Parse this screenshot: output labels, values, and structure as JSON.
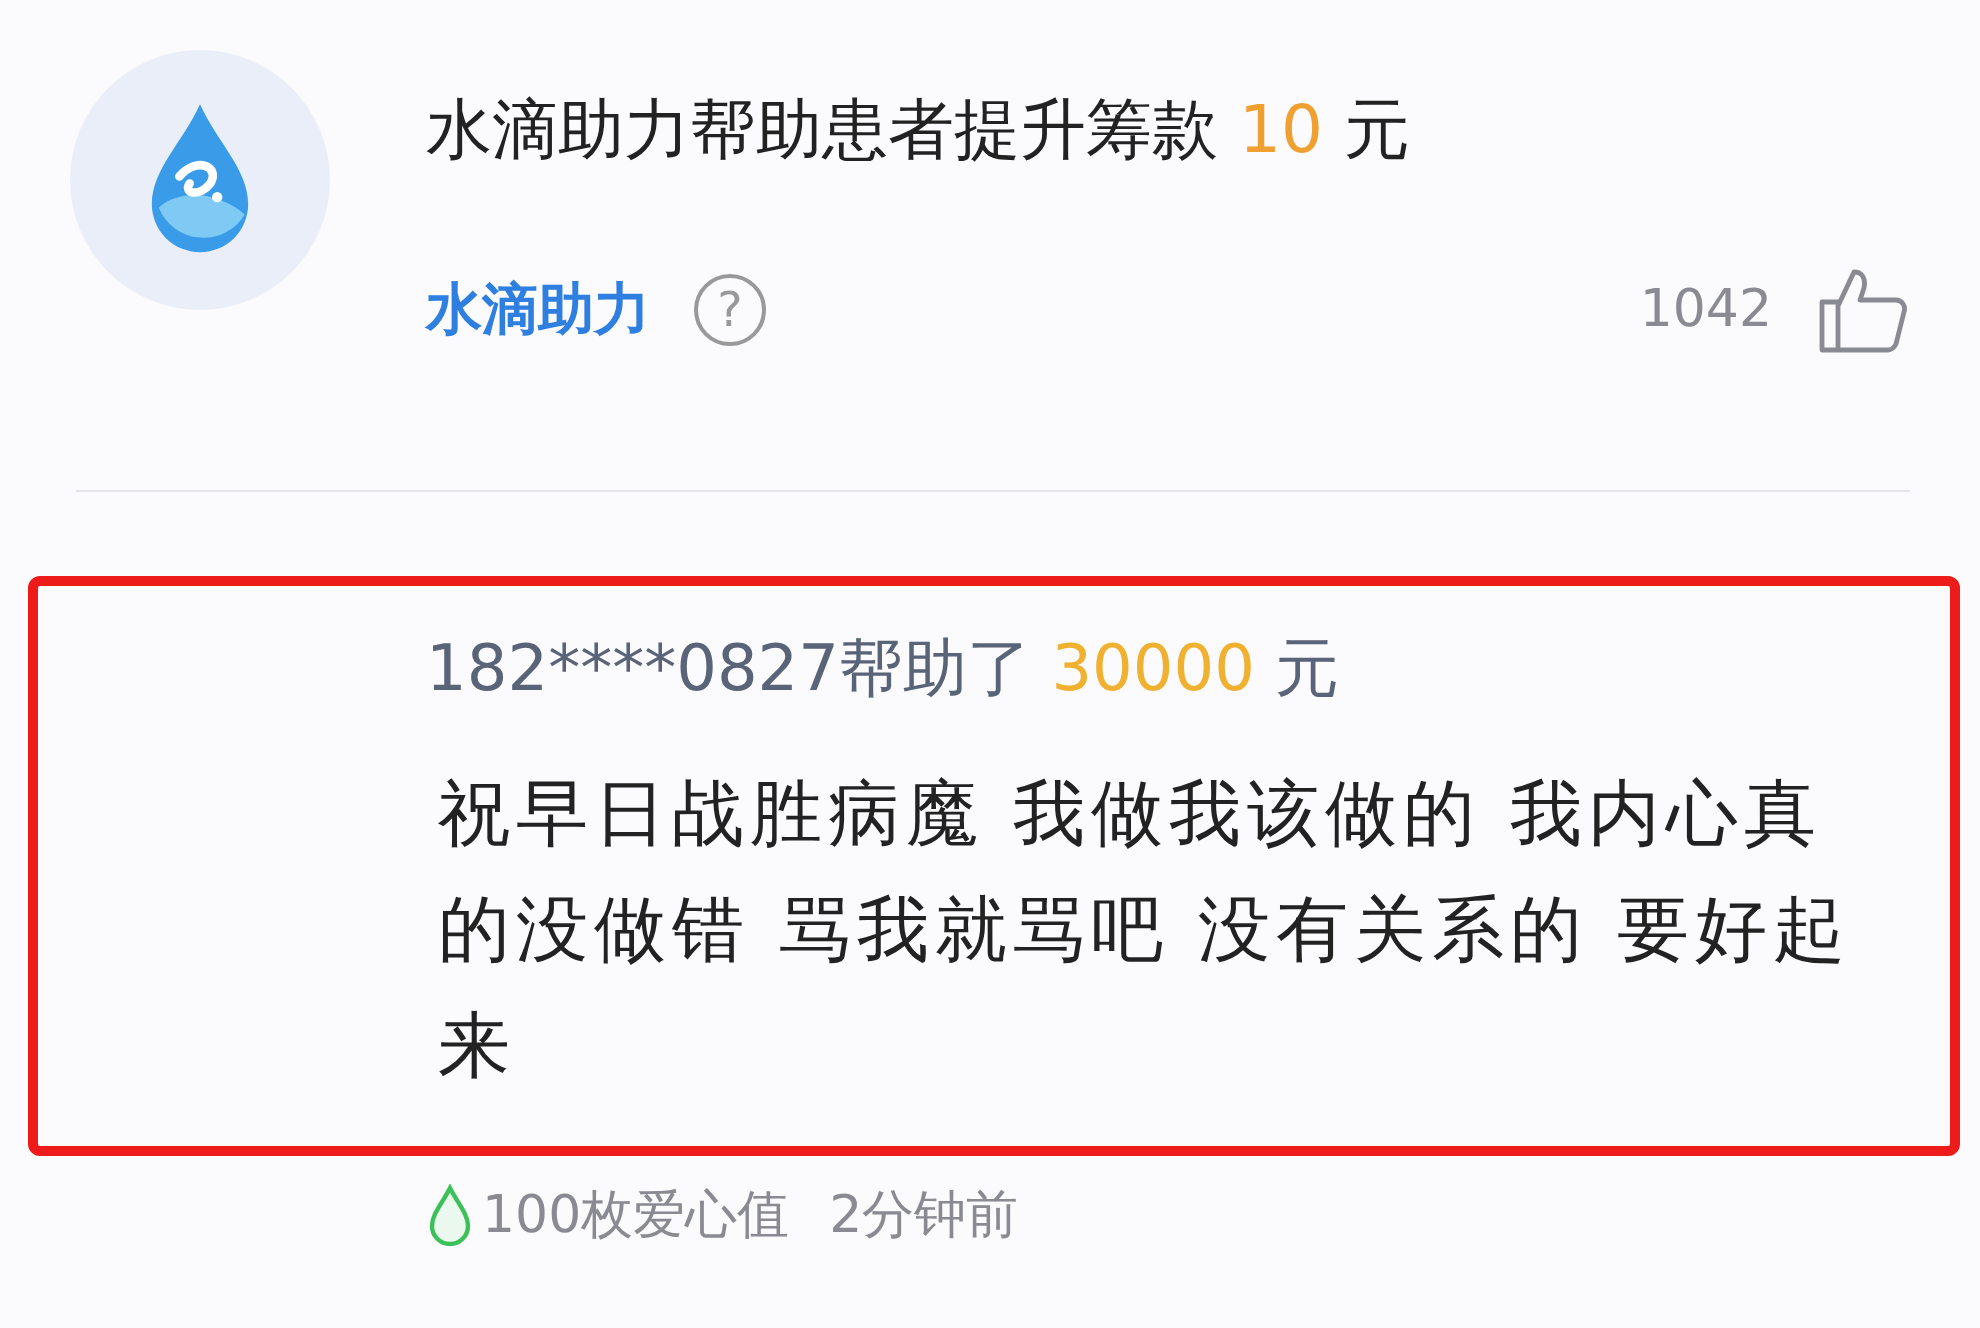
{
  "donation": {
    "title": "水滴助力帮助患者提升筹款",
    "amount": "10",
    "unit": "元",
    "source": "水滴助力",
    "help_icon": "?",
    "likes": "1042"
  },
  "comment": {
    "highlighted": true,
    "user": "182****0827",
    "action": "帮助了",
    "amount": "30000",
    "unit": "元",
    "message": "祝早日战胜病魔 我做我该做的 我内心真的没做错 骂我就骂吧 没有关系的 要好起来",
    "love": "100枚爱心值",
    "time": "2分钟前"
  }
}
